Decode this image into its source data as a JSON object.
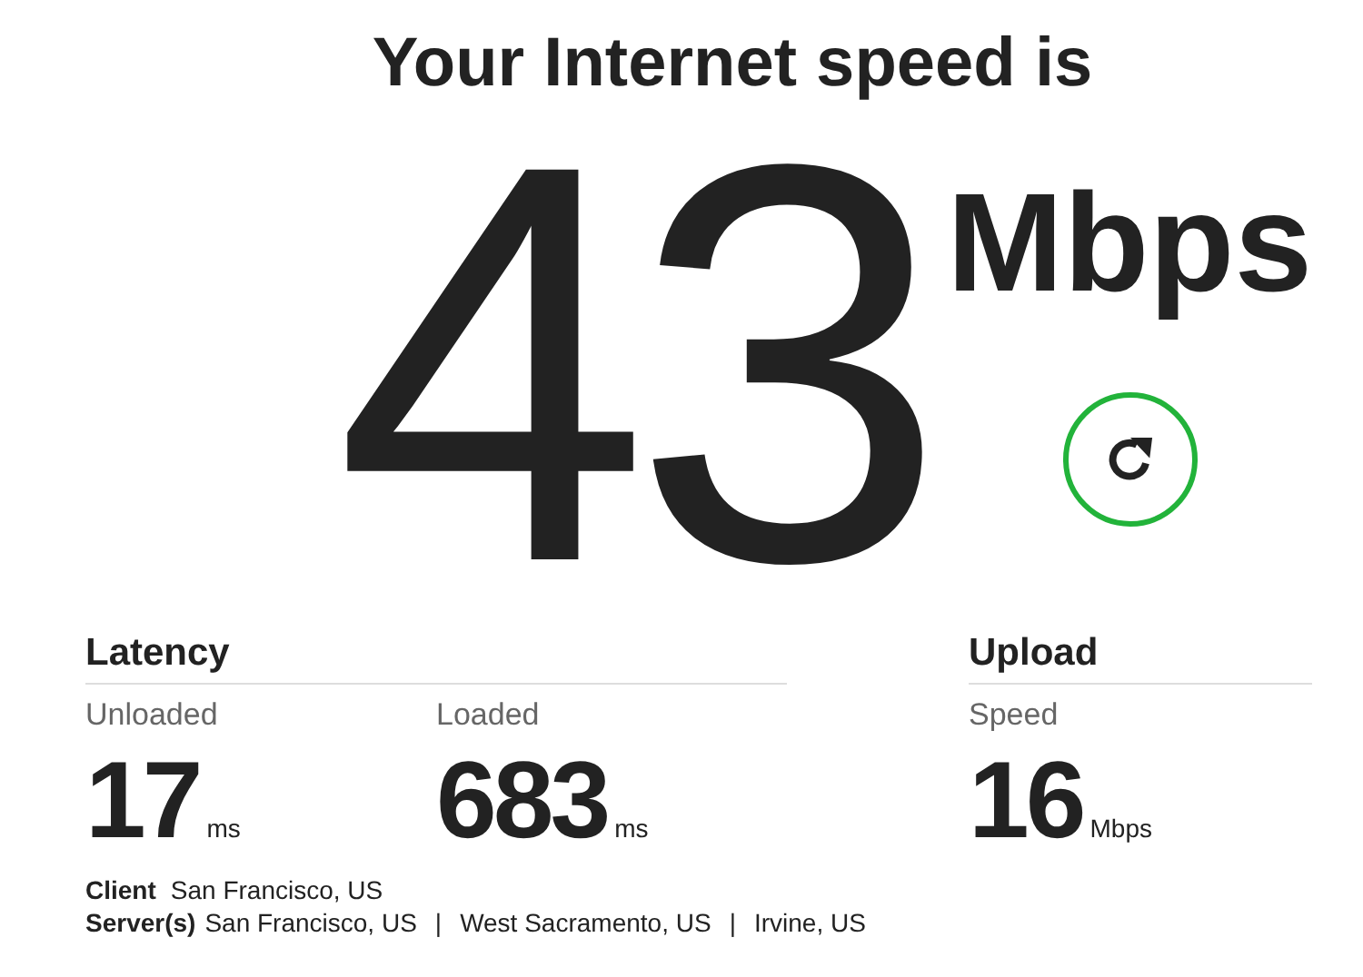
{
  "title": "Your Internet speed is",
  "speed": {
    "value": "43",
    "unit": "Mbps"
  },
  "sections": [
    {
      "heading": "Latency",
      "metrics": [
        {
          "label": "Unloaded",
          "value": "17",
          "unit": "ms"
        },
        {
          "label": "Loaded",
          "value": "683",
          "unit": "ms"
        }
      ]
    },
    {
      "heading": "Upload",
      "metrics": [
        {
          "label": "Speed",
          "value": "16",
          "unit": "Mbps"
        }
      ]
    }
  ],
  "client": {
    "label": "Client",
    "value": "San Francisco, US"
  },
  "servers": {
    "label": "Server(s)",
    "items": [
      "San Francisco, US",
      "West Sacramento, US",
      "Irvine, US"
    ],
    "separator": "|"
  }
}
